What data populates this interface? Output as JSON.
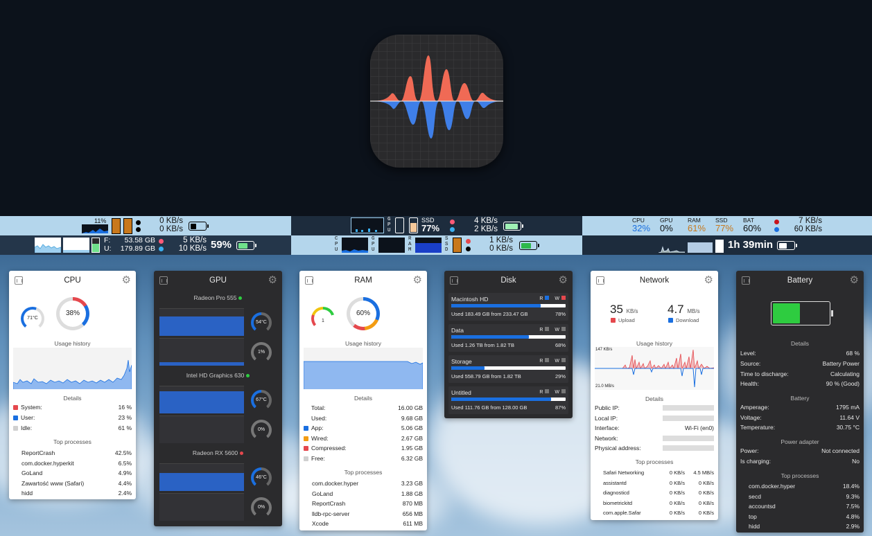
{
  "menubar": {
    "a1": {
      "cpu_pct": "11%",
      "net_up": "0 KB/s",
      "net_down": "0 KB/s"
    },
    "a2": {
      "disk_f_label": "F:",
      "disk_f": "53.58 GB",
      "disk_u_label": "U:",
      "disk_u": "179.89 GB",
      "net_up": "5 KB/s",
      "net_down": "10 KB/s",
      "battery": "59%"
    },
    "b1": {
      "gpu_label": "G\nP\nU",
      "ssd_label": "SSD",
      "ssd_value": "77%",
      "net_up": "4 KB/s",
      "net_down": "2 KB/s"
    },
    "b2": {
      "cpu_label": "C\nP\nU",
      "gpu_label": "G\nP\nU",
      "ram_label": "R\nA\nM",
      "ssd_label": "S\nS\nD",
      "net_up": "1 KB/s",
      "net_down": "0 KB/s"
    },
    "c1": {
      "labels": [
        "CPU",
        "GPU",
        "RAM",
        "SSD",
        "BAT"
      ],
      "values": [
        "32%",
        "0%",
        "61%",
        "77%",
        "60%"
      ],
      "colors": [
        "#1a6fe0",
        "#111111",
        "#c8781c",
        "#c8781c",
        "#111111"
      ],
      "net_up": "7 KB/s",
      "net_down": "60 KB/s"
    },
    "c2": {
      "time": "1h 39min"
    }
  },
  "cpu": {
    "title": "CPU",
    "temp": "71°C",
    "usage": "38%",
    "usage_history": "Usage history",
    "details": "Details",
    "rows": [
      {
        "label": "System:",
        "value": "16 %",
        "color": "#e5484d"
      },
      {
        "label": "User:",
        "value": "23 %",
        "color": "#1a6fe0"
      },
      {
        "label": "Idle:",
        "value": "61 %",
        "color": "#d0d0d0"
      }
    ],
    "top_processes": "Top processes",
    "procs": [
      {
        "name": "ReportCrash",
        "value": "42.5%"
      },
      {
        "name": "com.docker.hyperkit",
        "value": "6.5%"
      },
      {
        "name": "GoLand",
        "value": "4.9%"
      },
      {
        "name": "Zawartość www (Safari)",
        "value": "4.4%"
      },
      {
        "name": "hidd",
        "value": "2.4%"
      }
    ]
  },
  "gpu": {
    "title": "GPU",
    "devices": [
      {
        "name": "Radeon Pro 555",
        "status": "#2ecc40",
        "temp": "54°C",
        "util": "1%"
      },
      {
        "name": "Intel HD Graphics 630",
        "status": "#2ecc40",
        "temp": "67°C",
        "util": "0%"
      },
      {
        "name": "Radeon RX 5600",
        "status": "#e5484d",
        "temp": "46°C",
        "util": "0%"
      }
    ]
  },
  "ram": {
    "title": "RAM",
    "pressure": "1",
    "usage": "60%",
    "usage_history": "Usage history",
    "details": "Details",
    "rows": [
      {
        "label": "Total:",
        "value": "16.00 GB",
        "color": ""
      },
      {
        "label": "Used:",
        "value": "9.68 GB",
        "color": ""
      },
      {
        "label": "App:",
        "value": "5.06 GB",
        "color": "#1a6fe0"
      },
      {
        "label": "Wired:",
        "value": "2.67 GB",
        "color": "#f39c12"
      },
      {
        "label": "Compressed:",
        "value": "1.95 GB",
        "color": "#e5484d"
      },
      {
        "label": "Free:",
        "value": "6.32 GB",
        "color": "#d0d0d0"
      }
    ],
    "top_processes": "Top processes",
    "procs": [
      {
        "name": "com.docker.hyper",
        "value": "3.23 GB"
      },
      {
        "name": "GoLand",
        "value": "1.88 GB"
      },
      {
        "name": "ReportCrash",
        "value": "870 MB"
      },
      {
        "name": "lldb-rpc-server",
        "value": "656 MB"
      },
      {
        "name": "Xcode",
        "value": "611 MB"
      }
    ]
  },
  "disk": {
    "title": "Disk",
    "read": "R",
    "write": "W",
    "volumes": [
      {
        "name": "Macintosh HD",
        "used": "Used 183.49 GB from 233.47 GB",
        "pct": "78%",
        "fill": 0.78
      },
      {
        "name": "Data",
        "used": "Used 1.26 TB from 1.82 TB",
        "pct": "68%",
        "fill": 0.68
      },
      {
        "name": "Storage",
        "used": "Used 558.79 GB from 1.82 TB",
        "pct": "29%",
        "fill": 0.29
      },
      {
        "name": "Untitled",
        "used": "Used 111.76 GB from 128.00 GB",
        "pct": "87%",
        "fill": 0.87
      }
    ]
  },
  "network": {
    "title": "Network",
    "upload_value": "35",
    "upload_unit": "KB/s",
    "upload_label": "Upload",
    "download_value": "4.7",
    "download_unit": "MB/s",
    "download_label": "Download",
    "usage_history": "Usage history",
    "chart_max": "147 KB/s",
    "chart_min": "21.0 MB/s",
    "details": "Details",
    "rows": [
      {
        "label": "Public IP:",
        "value": ""
      },
      {
        "label": "Local IP:",
        "value": ""
      },
      {
        "label": "Interface:",
        "value": "Wi-Fi (en0)"
      },
      {
        "label": "Network:",
        "value": ""
      },
      {
        "label": "Physical address:",
        "value": ""
      }
    ],
    "top_processes": "Top processes",
    "procs": [
      {
        "name": "Safari Networking",
        "up": "0 KB/s",
        "down": "4.5 MB/s"
      },
      {
        "name": "assistantd",
        "up": "0 KB/s",
        "down": "0 KB/s"
      },
      {
        "name": "diagnosticd",
        "up": "0 KB/s",
        "down": "0 KB/s"
      },
      {
        "name": "biometrickitd",
        "up": "0 KB/s",
        "down": "0 KB/s"
      },
      {
        "name": "com.apple.Safar",
        "up": "0 KB/s",
        "down": "0 KB/s"
      }
    ]
  },
  "battery": {
    "title": "Battery",
    "level_fill": 0.68,
    "details": "Details",
    "rows": [
      {
        "label": "Level:",
        "value": "68 %"
      },
      {
        "label": "Source:",
        "value": "Battery Power"
      },
      {
        "label": "Time to discharge:",
        "value": "Calculating"
      },
      {
        "label": "Health:",
        "value": "90 % (Good)"
      }
    ],
    "battery_section": "Battery",
    "rows2": [
      {
        "label": "Amperage:",
        "value": "1795 mA"
      },
      {
        "label": "Voltage:",
        "value": "11.64 V"
      },
      {
        "label": "Temperature:",
        "value": "30.75 °C"
      }
    ],
    "power_section": "Power adapter",
    "rows3": [
      {
        "label": "Power:",
        "value": "Not connected"
      },
      {
        "label": "Is charging:",
        "value": "No"
      }
    ],
    "top_processes": "Top processes",
    "procs": [
      {
        "name": "com.docker.hyper",
        "value": "18.4%"
      },
      {
        "name": "secd",
        "value": "9.3%"
      },
      {
        "name": "accountsd",
        "value": "7.5%"
      },
      {
        "name": "top",
        "value": "4.8%"
      },
      {
        "name": "hidd",
        "value": "2.9%"
      }
    ]
  }
}
